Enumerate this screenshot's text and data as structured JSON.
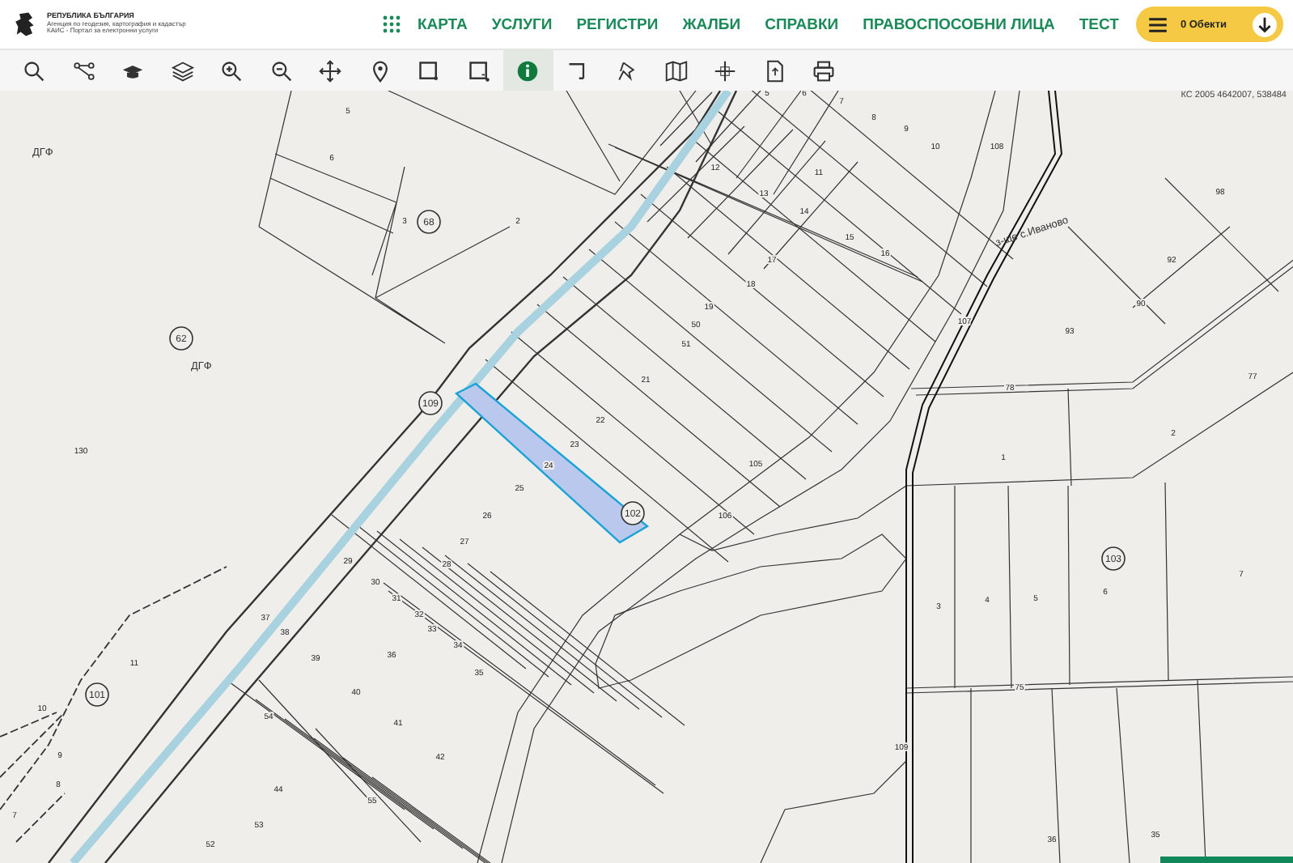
{
  "header": {
    "logo_title": "РЕПУБЛИКА БЪЛГАРИЯ",
    "logo_subtitle": "Агенция по геодезия, картография и кадастър",
    "logo_caption": "КАИС - Портал за електронни услуги",
    "nav": [
      {
        "label": "КАРТА"
      },
      {
        "label": "УСЛУГИ"
      },
      {
        "label": "РЕГИСТРИ"
      },
      {
        "label": "ЖАЛБИ"
      },
      {
        "label": "СПРАВКИ"
      },
      {
        "label": "ПРАВОСПОСОБНИ ЛИЦА"
      },
      {
        "label": "ТЕСТ"
      }
    ],
    "objects_button": "0 Обекти"
  },
  "toolbar": [
    {
      "selected": false
    },
    {
      "selected": false
    },
    {
      "selected": false
    },
    {
      "selected": false
    },
    {
      "selected": false
    },
    {
      "selected": false
    },
    {
      "selected": false
    },
    {
      "selected": false
    },
    {
      "selected": false
    },
    {
      "selected": false
    },
    {
      "selected": true
    },
    {
      "selected": false
    },
    {
      "selected": false
    },
    {
      "selected": false
    },
    {
      "selected": false
    },
    {
      "selected": false
    },
    {
      "selected": false
    }
  ],
  "map": {
    "coordinates": "КС 2005 4642007, 538484",
    "area_labels": [
      "ДГФ",
      "ДГФ",
      "з-ще с.Иваново"
    ],
    "circled_numbers": [
      "68",
      "62",
      "109",
      "102",
      "101",
      "103"
    ],
    "parcel_numbers": [
      "5",
      "6",
      "3",
      "2",
      "130",
      "22",
      "23",
      "24",
      "25",
      "26",
      "27",
      "28",
      "29",
      "30",
      "31",
      "32",
      "33",
      "34",
      "35",
      "36",
      "37",
      "38",
      "39",
      "40",
      "41",
      "42",
      "54",
      "44",
      "55",
      "53",
      "52",
      "11",
      "10",
      "9",
      "8",
      "7",
      "106",
      "105",
      "21",
      "50",
      "51",
      "19",
      "18",
      "17",
      "12",
      "13",
      "14",
      "15",
      "16",
      "11",
      "5",
      "6",
      "7",
      "8",
      "9",
      "10",
      "108",
      "107",
      "98",
      "92",
      "90",
      "93",
      "77",
      "78",
      "2",
      "1",
      "3",
      "4",
      "5",
      "6",
      "7",
      "75",
      "109",
      "36",
      "35"
    ]
  }
}
